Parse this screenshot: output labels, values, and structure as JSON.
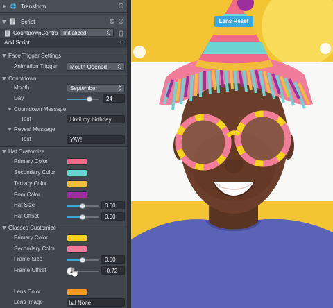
{
  "transform": {
    "title": "Transform"
  },
  "script": {
    "title": "Script",
    "script_name": "CountdownContro",
    "state": "Initialized",
    "add_script_label": "Add Script",
    "add_icon": "+"
  },
  "face_trigger": {
    "section_label": "Face Trigger Settings",
    "animation_trigger_label": "Animation Trigger",
    "animation_trigger_value": "Mouth Opened"
  },
  "countdown": {
    "section_label": "Countdown",
    "month_label": "Month",
    "month_value": "September",
    "day_label": "Day",
    "day_value": "24",
    "day_level": 0.72,
    "countdown_message_label": "Countdown Message",
    "countdown_text_label": "Text",
    "countdown_text_value": "Until my birthday",
    "reveal_message_label": "Reveal Message",
    "reveal_text_label": "Text",
    "reveal_text_value": "YAY!"
  },
  "hat": {
    "section_label": "Hat Customize",
    "primary_label": "Primary Color",
    "primary_color": "#f06a8a",
    "secondary_label": "Secondary Color",
    "secondary_color": "#6ad4d2",
    "tertiary_label": "Tertiary Color",
    "tertiary_color": "#f2bd3b",
    "pom_label": "Pom Color",
    "pom_color": "#9c2f9d",
    "size_label": "Hat Size",
    "size_value": "0.00",
    "size_level": 0.5,
    "offset_label": "Hat Offset",
    "offset_value": "0.00",
    "offset_level": 0.5
  },
  "glasses": {
    "section_label": "Glasses Customize",
    "primary_label": "Primary Color",
    "primary_color": "#f5d21c",
    "secondary_label": "Secondary Color",
    "secondary_color": "#f27d9b",
    "frame_size_label": "Frame Size",
    "frame_size_value": "0.00",
    "frame_size_level": 0.5,
    "frame_offset_label": "Frame Offset",
    "frame_offset_value": "-0.72",
    "frame_offset_level": 0.14,
    "lens_color_label": "Lens Color",
    "lens_color": "#f29a1c",
    "lens_image_label": "Lens Image",
    "lens_image_value": "None"
  },
  "preview": {
    "lens_reset_label": "Lens Reset"
  }
}
